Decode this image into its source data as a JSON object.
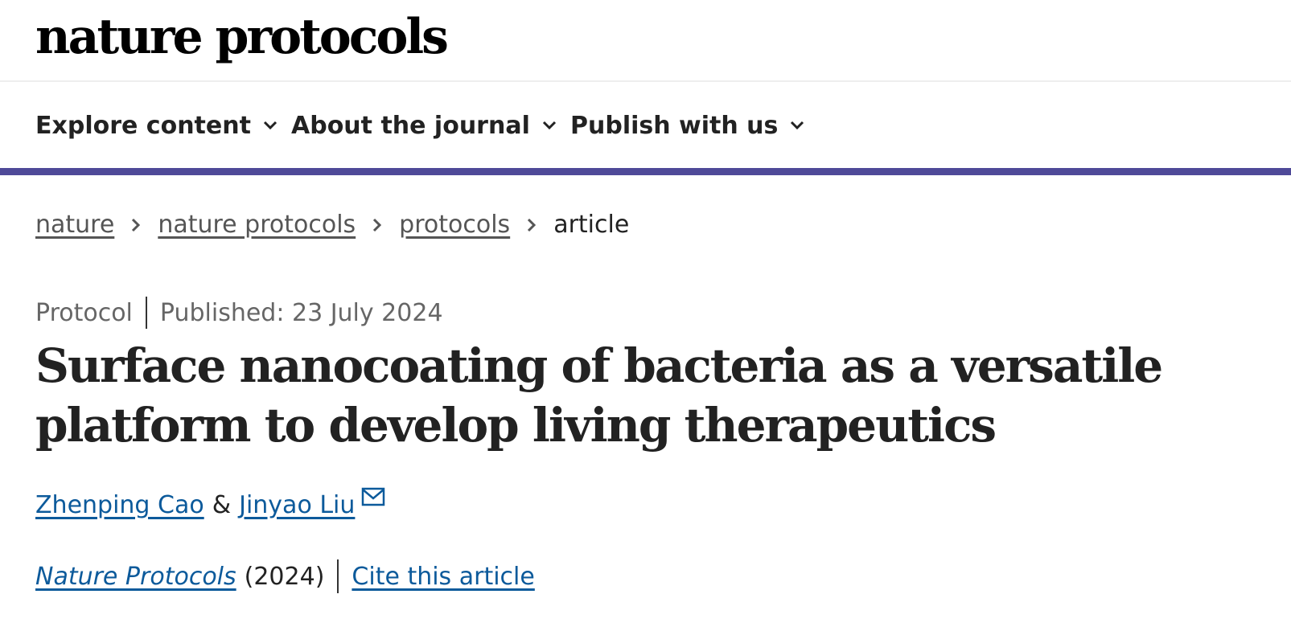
{
  "header": {
    "logo_text": "nature protocols"
  },
  "nav": {
    "items": [
      {
        "label": "Explore content"
      },
      {
        "label": "About the journal"
      },
      {
        "label": "Publish with us"
      }
    ]
  },
  "colors": {
    "accent_bar": "#4f4a98",
    "link": "#0c5a9b"
  },
  "breadcrumb": {
    "items": [
      {
        "label": "nature"
      },
      {
        "label": "nature protocols"
      },
      {
        "label": "protocols"
      }
    ],
    "current": "article"
  },
  "article": {
    "type": "Protocol",
    "published": "Published: 23 July 2024",
    "title": "Surface nanocoating of bacteria as a versatile platform to develop living therapeutics",
    "authors": [
      {
        "name": "Zhenping Cao"
      },
      {
        "name": "Jinyao Liu"
      }
    ],
    "author_separator": "&",
    "journal": "Nature Protocols",
    "year": "(2024)",
    "cite_label": "Cite this article"
  },
  "icons": {
    "nav_chevron": "chevron-down-icon",
    "breadcrumb_separator": "chevron-right-icon",
    "author_contact": "mail-icon"
  }
}
